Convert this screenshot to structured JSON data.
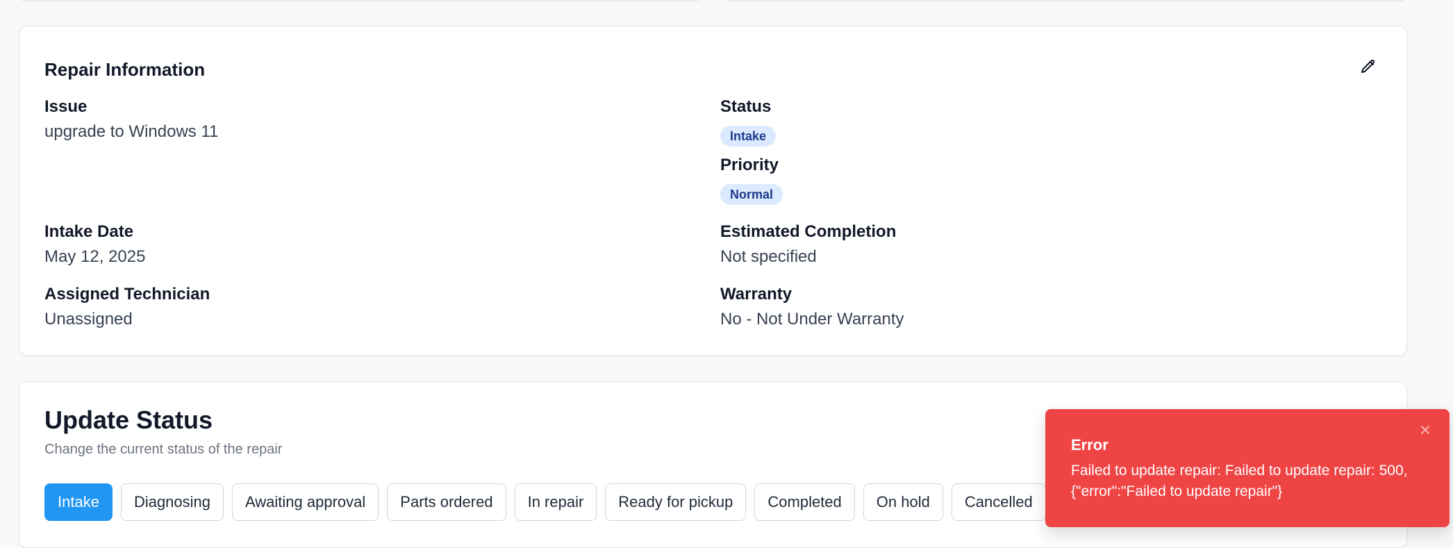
{
  "repair_info": {
    "title": "Repair Information",
    "issue_label": "Issue",
    "issue_value": "upgrade to Windows 11",
    "status_label": "Status",
    "status_value": "Intake",
    "priority_label": "Priority",
    "priority_value": "Normal",
    "intake_date_label": "Intake Date",
    "intake_date_value": "May 12, 2025",
    "estimated_completion_label": "Estimated Completion",
    "estimated_completion_value": "Not specified",
    "technician_label": "Assigned Technician",
    "technician_value": "Unassigned",
    "warranty_label": "Warranty",
    "warranty_value": "No - Not Under Warranty"
  },
  "update_status": {
    "title": "Update Status",
    "subtitle": "Change the current status of the repair",
    "buttons": [
      "Intake",
      "Diagnosing",
      "Awaiting approval",
      "Parts ordered",
      "In repair",
      "Ready for pickup",
      "Completed",
      "On hold",
      "Cancelled"
    ],
    "active": "Intake"
  },
  "toast": {
    "title": "Error",
    "message": "Failed to update repair: Failed to update repair: 500, {\"error\":\"Failed to update repair\"}",
    "close_glyph": "✕"
  },
  "colors": {
    "accent": "#2196f3",
    "badge_bg": "#dbeafe",
    "badge_text": "#1e3a8a",
    "error": "#ef4444"
  }
}
